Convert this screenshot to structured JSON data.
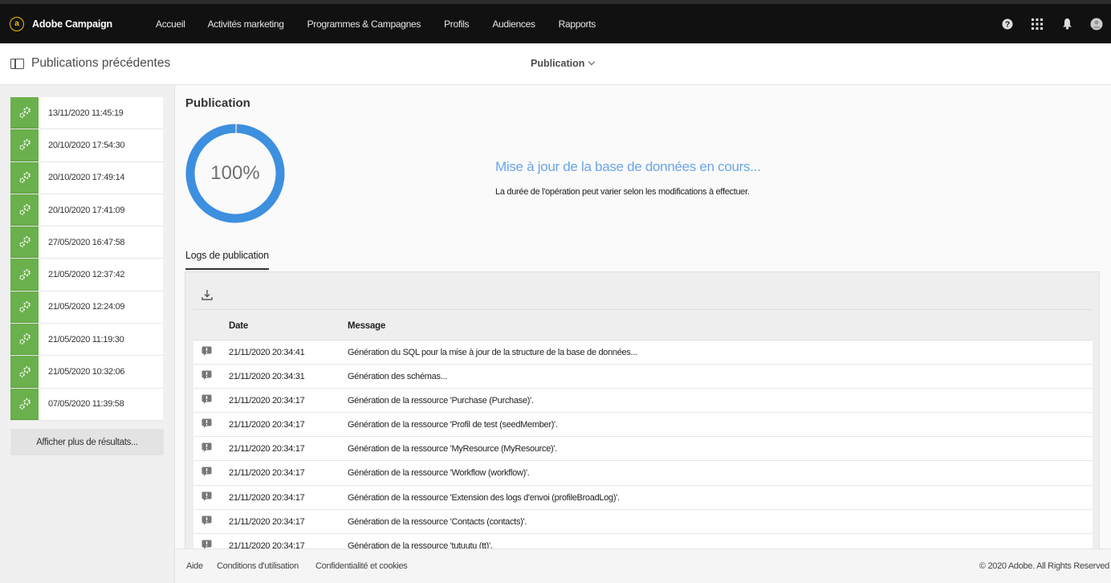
{
  "app": {
    "brand": "Adobe Campaign",
    "logo_glyph": "a",
    "nav": [
      "Accueil",
      "Activités marketing",
      "Programmes & Campagnes",
      "Profils",
      "Audiences",
      "Rapports"
    ],
    "icons": [
      "help-icon",
      "apps-grid-icon",
      "notifications-bell-icon",
      "user-avatar-icon"
    ]
  },
  "subheader": {
    "title": "Publications précédentes",
    "dropdown_label": "Publication"
  },
  "sidebar": {
    "history": [
      "13/11/2020 11:45:19",
      "20/10/2020 17:54:30",
      "20/10/2020 17:49:14",
      "20/10/2020 17:41:09",
      "27/05/2020 16:47:58",
      "21/05/2020 12:37:42",
      "21/05/2020 12:24:09",
      "21/05/2020 11:19:30",
      "21/05/2020 10:32:06",
      "07/05/2020 11:39:58"
    ],
    "more_button": "Afficher plus de résultats..."
  },
  "main": {
    "section_title": "Publication",
    "progress_value": 100,
    "progress_label": "100%",
    "status_title": "Mise à jour de la base de données en cours...",
    "status_desc": "La durée de l'opération peut varier selon les modifications à effectuer.",
    "tab_label": "Logs de publication",
    "columns": {
      "date": "Date",
      "message": "Message"
    },
    "logs": [
      {
        "date": "21/11/2020 20:34:41",
        "message": "Génération du SQL pour la mise à jour de la structure de la base de données..."
      },
      {
        "date": "21/11/2020 20:34:31",
        "message": "Génération des schémas..."
      },
      {
        "date": "21/11/2020 20:34:17",
        "message": "Génération de la ressource 'Purchase (Purchase)'."
      },
      {
        "date": "21/11/2020 20:34:17",
        "message": "Génération de la ressource 'Profil de test (seedMember)'."
      },
      {
        "date": "21/11/2020 20:34:17",
        "message": "Génération de la ressource 'MyResource (MyResource)'."
      },
      {
        "date": "21/11/2020 20:34:17",
        "message": "Génération de la ressource 'Workflow (workflow)'."
      },
      {
        "date": "21/11/2020 20:34:17",
        "message": "Génération de la ressource 'Extension des logs d'envoi (profileBroadLog)'."
      },
      {
        "date": "21/11/2020 20:34:17",
        "message": "Génération de la ressource 'Contacts (contacts)'."
      },
      {
        "date": "21/11/2020 20:34:17",
        "message": "Génération de la ressource 'tutuutu (tt)'."
      }
    ]
  },
  "footer": {
    "links": [
      "Aide",
      "Conditions d'utilisation",
      "Confidentialité et cookies"
    ],
    "copyright": "© 2020 Adobe. All Rights Reserved"
  },
  "colors": {
    "topbar": "#111111",
    "accent_green": "#6ab04c",
    "progress_blue": "#3d8fe0",
    "status_blue": "#6aa5e5"
  }
}
